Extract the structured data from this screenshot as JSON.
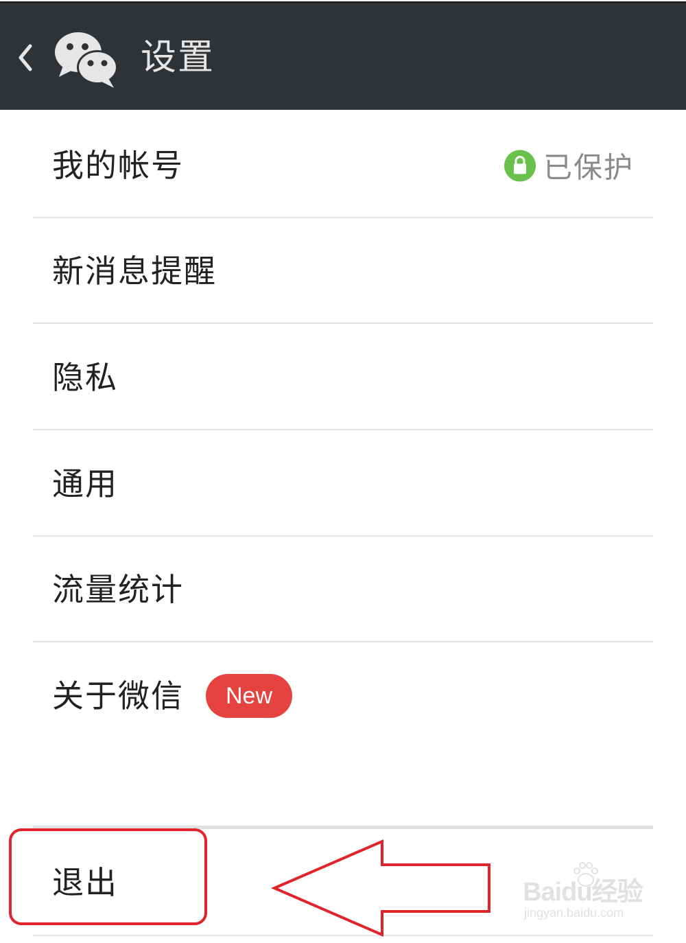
{
  "header": {
    "title": "设置",
    "back_icon": "chevron-left-icon",
    "logo_icon": "wechat-logo-icon",
    "background_color": "#2f3336"
  },
  "menu": {
    "items": [
      {
        "label": "我的帐号",
        "status": "已保护",
        "status_icon": "lock-icon"
      },
      {
        "label": "新消息提醒"
      },
      {
        "label": "隐私"
      },
      {
        "label": "通用"
      },
      {
        "label": "流量统计"
      },
      {
        "label": "关于微信",
        "badge": "New"
      }
    ]
  },
  "logout": {
    "label": "退出"
  },
  "annotation": {
    "highlight_color": "#e0242b",
    "arrow_direction": "left"
  },
  "watermark": {
    "logo_text": "Baidu经验",
    "url": "jingyan.baidu.com"
  },
  "colors": {
    "protected_green": "#6bc04b",
    "badge_red": "#e64340"
  }
}
